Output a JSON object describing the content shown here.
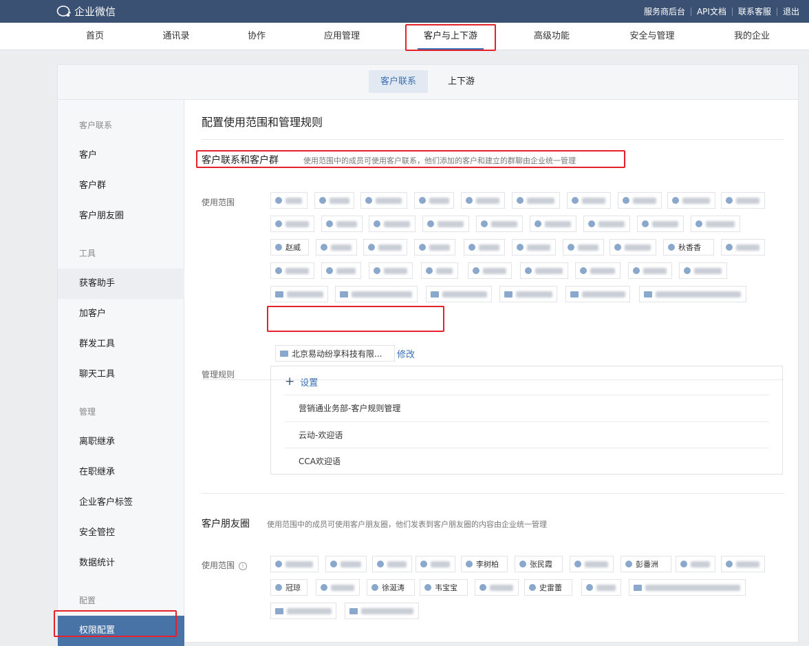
{
  "app": {
    "name": "企业微信"
  },
  "topbar": {
    "links": [
      "服务商后台",
      "API文档",
      "联系客服",
      "退出"
    ]
  },
  "nav": {
    "items": [
      "首页",
      "通讯录",
      "协作",
      "应用管理",
      "客户与上下游",
      "高级功能",
      "安全与管理",
      "我的企业"
    ],
    "active_index": 4
  },
  "subtabs": {
    "items": [
      "客户联系",
      "上下游"
    ],
    "active_index": 0
  },
  "sidebar": {
    "groups": [
      {
        "title": "客户联系",
        "items": [
          "客户",
          "客户群",
          "客户朋友圈"
        ]
      },
      {
        "title": "工具",
        "items": [
          "获客助手",
          "加客户",
          "群发工具",
          "聊天工具"
        ]
      },
      {
        "title": "管理",
        "items": [
          "离职继承",
          "在职继承",
          "企业客户标签",
          "安全管控",
          "数据统计"
        ]
      },
      {
        "title": "配置",
        "items": [
          "权限配置"
        ]
      }
    ],
    "selected": "权限配置"
  },
  "main": {
    "title": "配置使用范围和管理规则",
    "section1": {
      "title": "客户联系和客户群",
      "desc": "使用范围中的成员可使用客户联系，他们添加的客户和建立的群聊由企业统一管理",
      "scope_label": "使用范围",
      "visible_people": [
        "赵威",
        "秋香香"
      ],
      "dept_chip": "北京易动纷享科技有限...",
      "edit_label": "修改",
      "rules_label": "管理规则",
      "add_rule_label": "设置",
      "rules": [
        "营销通业务部-客户规则管理",
        "云动-欢迎语",
        "CCA欢迎语"
      ]
    },
    "section2": {
      "title": "客户朋友圈",
      "desc": "使用范围中的成员可使用客户朋友圈，他们发表到客户朋友圈的内容由企业统一管理",
      "scope_label": "使用范围",
      "visible_people": [
        "李树柏",
        "张民霞",
        "彭番洲",
        "冠琼",
        "徐涎涛",
        "韦宝宝",
        "史雷蕾"
      ]
    }
  }
}
